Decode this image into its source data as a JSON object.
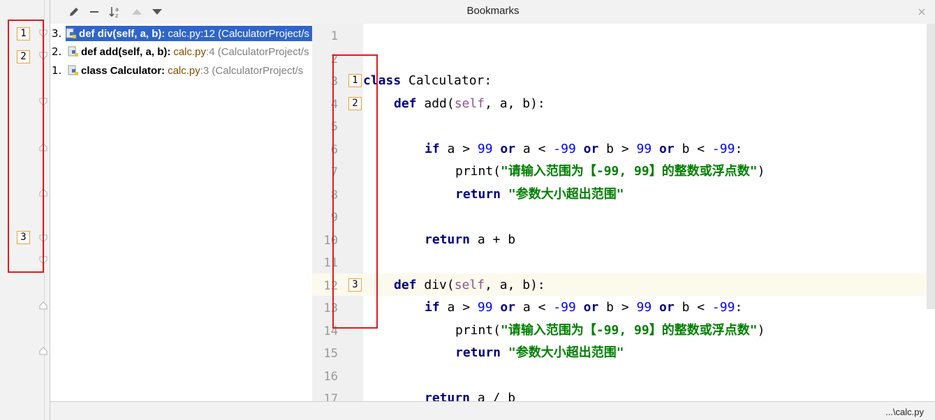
{
  "left_gutter": {
    "marks": [
      "1",
      "2",
      "3"
    ]
  },
  "popup": {
    "title": "Bookmarks",
    "toolbar": {
      "edit_icon": "pencil-icon",
      "remove_icon": "minus-icon",
      "sort_icon": "sort-alpha-icon",
      "up_icon": "triangle-up-icon",
      "down_icon": "triangle-down-icon"
    },
    "items": [
      {
        "num": "3.",
        "sig": "def div(self, a, b):",
        "file": "calc.py",
        "loc": ":12 (CalculatorProject/s"
      },
      {
        "num": "2.",
        "sig": "def add(self, a, b):",
        "file": "calc.py",
        "loc": ":4 (CalculatorProject/s"
      },
      {
        "num": "1.",
        "sig": "class Calculator:",
        "file": "calc.py",
        "loc": ":3 (CalculatorProject/s"
      }
    ],
    "status_path": "...\\calc.py"
  },
  "editor": {
    "line_numbers": [
      "1",
      "2",
      "3",
      "4",
      "5",
      "6",
      "7",
      "8",
      "9",
      "10",
      "11",
      "12",
      "13",
      "14",
      "15",
      "16",
      "17"
    ],
    "bookmarks": [
      "1",
      "2",
      "3"
    ],
    "code": {
      "l3_kw": "class",
      "l3_rest": " Calculator:",
      "l4_kw": "def",
      "l4_name": " add(",
      "l4_self": "self",
      "l4_rest": ", a, b):",
      "l6_kw_if": "if",
      "l6_a": " a > ",
      "l6_n1": "99",
      "l6_or1": "or",
      "l6_b": " a < ",
      "l6_n2": "-99",
      "l6_or2": "or",
      "l6_c": " b > ",
      "l6_n3": "99",
      "l6_or3": "or",
      "l6_d": " b < ",
      "l6_n4": "-99",
      "l6_e": ":",
      "l7_fn": "print(",
      "l7_str": "\"请输入范围为【-99, 99】的整数或浮点数\"",
      "l7_end": ")",
      "l8_kw": "return",
      "l8_str": "\"参数大小超出范围\"",
      "l10_kw": "return",
      "l10_rest": " a + b",
      "l12_kw": "def",
      "l12_name": " div(",
      "l12_self": "self",
      "l12_rest": ", a, b):",
      "l13_kw_if": "if",
      "l13_a": " a > ",
      "l13_n1": "99",
      "l13_or1": "or",
      "l13_b": " a < ",
      "l13_n2": "-99",
      "l13_or2": "or",
      "l13_c": " b > ",
      "l13_n3": "99",
      "l13_or3": "or",
      "l13_d": " b < ",
      "l13_n4": "-99",
      "l13_e": ":",
      "l14_fn": "print(",
      "l14_str": "\"请输入范围为【-99, 99】的整数或浮点数\"",
      "l14_end": ")",
      "l15_kw": "return",
      "l15_str": "\"参数大小超出范围\"",
      "l17_kw": "return",
      "l17_rest": " a / b"
    }
  },
  "colors": {
    "selection": "#2f65ca",
    "bookmark_border": "#f0a030",
    "annotation_red": "#e01b1b",
    "keyword": "#000080",
    "number": "#0000ff",
    "string": "#008000"
  }
}
